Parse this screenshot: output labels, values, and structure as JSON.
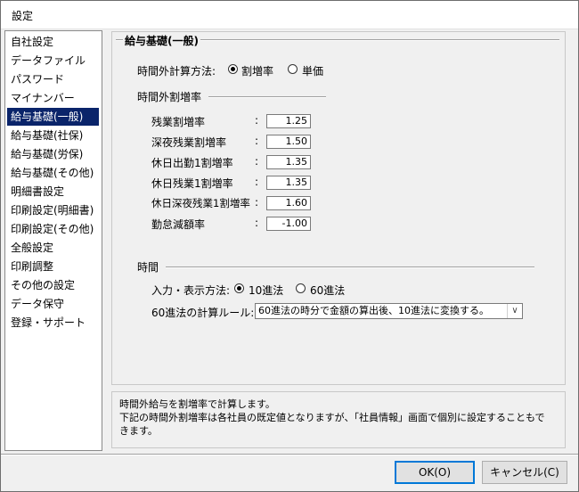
{
  "window": {
    "title": "設定"
  },
  "sidebar": {
    "items": [
      {
        "label": "自社設定",
        "selected": false
      },
      {
        "label": "データファイル",
        "selected": false
      },
      {
        "label": "パスワード",
        "selected": false
      },
      {
        "label": "マイナンバー",
        "selected": false
      },
      {
        "label": "給与基礎(一般)",
        "selected": true
      },
      {
        "label": "給与基礎(社保)",
        "selected": false
      },
      {
        "label": "給与基礎(労保)",
        "selected": false
      },
      {
        "label": "給与基礎(その他)",
        "selected": false
      },
      {
        "label": "明細書設定",
        "selected": false
      },
      {
        "label": "印刷設定(明細書)",
        "selected": false
      },
      {
        "label": "印刷設定(その他)",
        "selected": false
      },
      {
        "label": "全般設定",
        "selected": false
      },
      {
        "label": "印刷調整",
        "selected": false
      },
      {
        "label": "その他の設定",
        "selected": false
      },
      {
        "label": "データ保守",
        "selected": false
      },
      {
        "label": "登録・サポート",
        "selected": false
      }
    ]
  },
  "main": {
    "group_title": "給与基礎(一般)",
    "overtime_method": {
      "label": "時間外計算方法:",
      "options": [
        {
          "label": "割増率",
          "selected": true
        },
        {
          "label": "単価",
          "selected": false
        }
      ]
    },
    "rate_section": {
      "title": "時間外割増率",
      "colon": ":",
      "rows": [
        {
          "label": "残業割増率",
          "value": "1.25"
        },
        {
          "label": "深夜残業割増率",
          "value": "1.50"
        },
        {
          "label": "休日出勤1割増率",
          "value": "1.35"
        },
        {
          "label": "休日残業1割増率",
          "value": "1.35"
        },
        {
          "label": "休日深夜残業1割増率",
          "value": "1.60"
        },
        {
          "label": "勤怠減額率",
          "value": "-1.00"
        }
      ]
    },
    "time_section": {
      "title": "時間",
      "input_method": {
        "label": "入力・表示方法:",
        "options": [
          {
            "label": "10進法",
            "selected": true
          },
          {
            "label": "60進法",
            "selected": false
          }
        ]
      },
      "rule": {
        "label": "60進法の計算ルール:",
        "value": "60進法の時分で金額の算出後、10進法に変換する。"
      }
    }
  },
  "description": {
    "line1": "時間外給与を割増率で計算します。",
    "line2": "下記の時間外割増率は各社員の既定値となりますが、「社員情報」画面で個別に設定することもで",
    "line3": "きます。"
  },
  "buttons": {
    "ok": "OK(O)",
    "cancel": "キャンセル(C)"
  },
  "colors": {
    "selection": "#0a246a",
    "default_button_border": "#0078d7"
  }
}
